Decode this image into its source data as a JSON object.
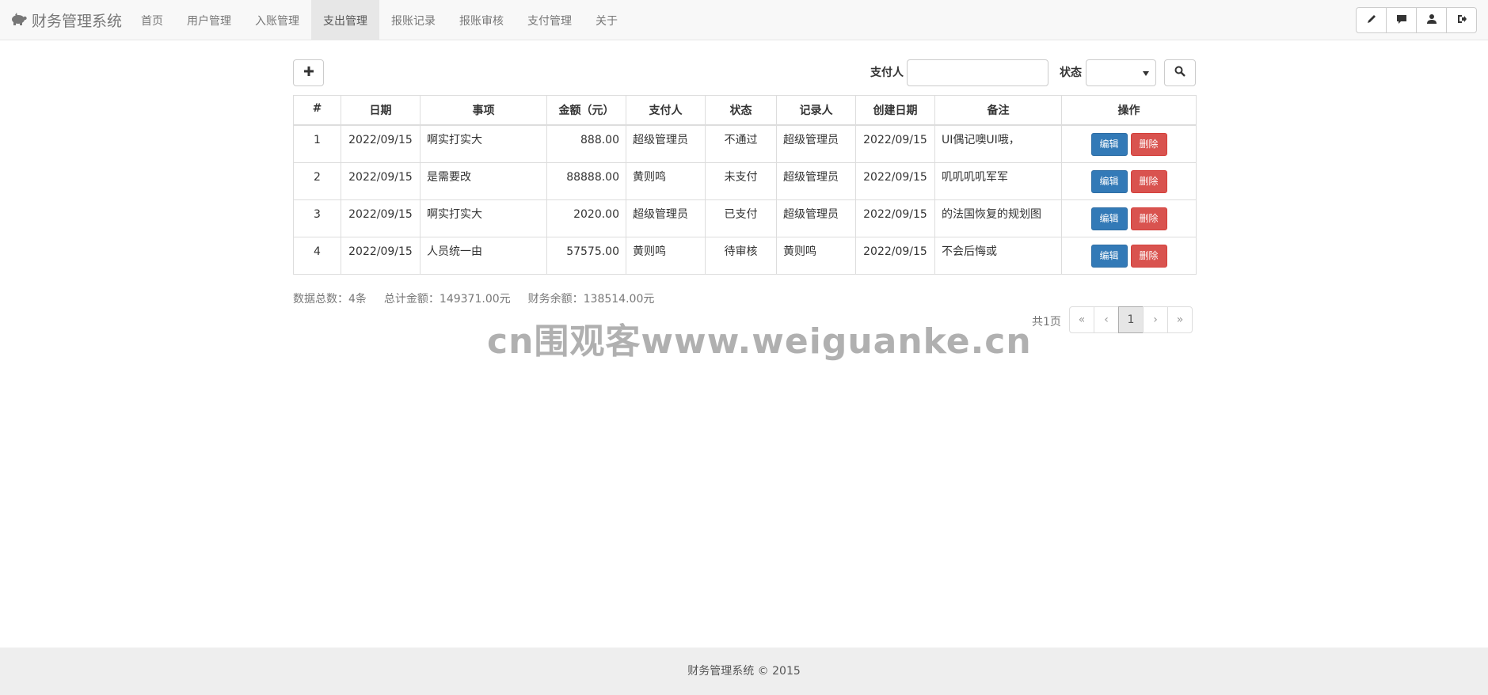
{
  "brand": {
    "title": "财务管理系统",
    "icon": "piggy-bank-icon"
  },
  "nav": [
    {
      "label": "首页",
      "active": false
    },
    {
      "label": "用户管理",
      "active": false
    },
    {
      "label": "入账管理",
      "active": false
    },
    {
      "label": "支出管理",
      "active": true
    },
    {
      "label": "报账记录",
      "active": false
    },
    {
      "label": "报账审核",
      "active": false
    },
    {
      "label": "支付管理",
      "active": false
    },
    {
      "label": "关于",
      "active": false
    }
  ],
  "right_icons": [
    "pencil-icon",
    "comment-icon",
    "user-icon",
    "logout-icon"
  ],
  "search": {
    "payer_label": "支付人",
    "payer_value": "",
    "status_label": "状态",
    "status_value": ""
  },
  "table": {
    "headers": [
      "#",
      "日期",
      "事项",
      "金额（元）",
      "支付人",
      "状态",
      "记录人",
      "创建日期",
      "备注",
      "操作"
    ],
    "edit_label": "编辑",
    "delete_label": "删除",
    "rows": [
      {
        "no": "1",
        "date": "2022/09/15",
        "item": "啊实打实大",
        "amount": "888.00",
        "payer": "超级管理员",
        "status": "不通过",
        "recorder": "超级管理员",
        "created": "2022/09/15",
        "note": "UI偶记噢UI哦，"
      },
      {
        "no": "2",
        "date": "2022/09/15",
        "item": "是需要改",
        "amount": "88888.00",
        "payer": "黄则鸣",
        "status": "未支付",
        "recorder": "超级管理员",
        "created": "2022/09/15",
        "note": "叽叽叽叽军军"
      },
      {
        "no": "3",
        "date": "2022/09/15",
        "item": "啊实打实大",
        "amount": "2020.00",
        "payer": "超级管理员",
        "status": "已支付",
        "recorder": "超级管理员",
        "created": "2022/09/15",
        "note": "的法国恢复的规划图"
      },
      {
        "no": "4",
        "date": "2022/09/15",
        "item": "人员统一由",
        "amount": "57575.00",
        "payer": "黄则鸣",
        "status": "待审核",
        "recorder": "黄则鸣",
        "created": "2022/09/15",
        "note": "不会后悔或"
      }
    ]
  },
  "summary": {
    "count_text": "数据总数：4条",
    "total_text": "总计金额：149371.00元",
    "balance_text": "财务余额：138514.00元"
  },
  "pagination": {
    "total_pages_text": "共1页",
    "first": "«",
    "prev": "‹",
    "current": "1",
    "next": "›",
    "last": "»"
  },
  "watermark": "cn围观客www.weiguanke.cn",
  "footer": "财务管理系统 © 2015"
}
